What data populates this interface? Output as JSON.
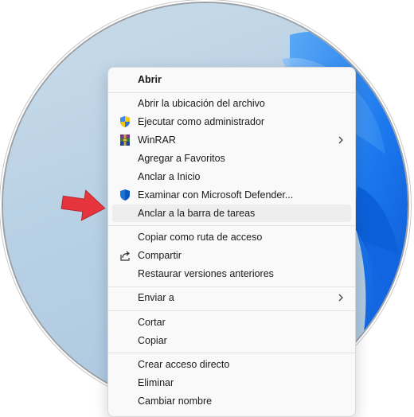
{
  "menu": {
    "items": [
      {
        "label": "Abrir",
        "icon": null,
        "bold": true,
        "submenu": false
      },
      {
        "label": "Abrir la ubicación del archivo",
        "icon": null,
        "bold": false,
        "submenu": false
      },
      {
        "label": "Ejecutar como administrador",
        "icon": "uac-shield-icon",
        "bold": false,
        "submenu": false
      },
      {
        "label": "WinRAR",
        "icon": "winrar-icon",
        "bold": false,
        "submenu": true
      },
      {
        "label": "Agregar a Favoritos",
        "icon": null,
        "bold": false,
        "submenu": false
      },
      {
        "label": "Anclar a Inicio",
        "icon": null,
        "bold": false,
        "submenu": false
      },
      {
        "label": "Examinar con Microsoft Defender...",
        "icon": "defender-shield-icon",
        "bold": false,
        "submenu": false
      },
      {
        "label": "Anclar a la barra de tareas",
        "icon": null,
        "bold": false,
        "submenu": false,
        "highlighted": true
      },
      {
        "label": "Copiar como ruta de acceso",
        "icon": null,
        "bold": false,
        "submenu": false
      },
      {
        "label": "Compartir",
        "icon": "share-icon",
        "bold": false,
        "submenu": false
      },
      {
        "label": "Restaurar versiones anteriores",
        "icon": null,
        "bold": false,
        "submenu": false
      },
      {
        "label": "Enviar a",
        "icon": null,
        "bold": false,
        "submenu": true
      },
      {
        "label": "Cortar",
        "icon": null,
        "bold": false,
        "submenu": false
      },
      {
        "label": "Copiar",
        "icon": null,
        "bold": false,
        "submenu": false
      },
      {
        "label": "Crear acceso directo",
        "icon": null,
        "bold": false,
        "submenu": false
      },
      {
        "label": "Eliminar",
        "icon": null,
        "bold": false,
        "submenu": false
      },
      {
        "label": "Cambiar nombre",
        "icon": null,
        "bold": false,
        "submenu": false
      }
    ]
  },
  "colors": {
    "menu_background": "#f9f9f9",
    "hover_background": "#ededed",
    "pointer_arrow": "#e5343c",
    "wallpaper_accent": "#0a6cf0"
  },
  "annotation": {
    "icon": "red-pointer-arrow-icon"
  }
}
